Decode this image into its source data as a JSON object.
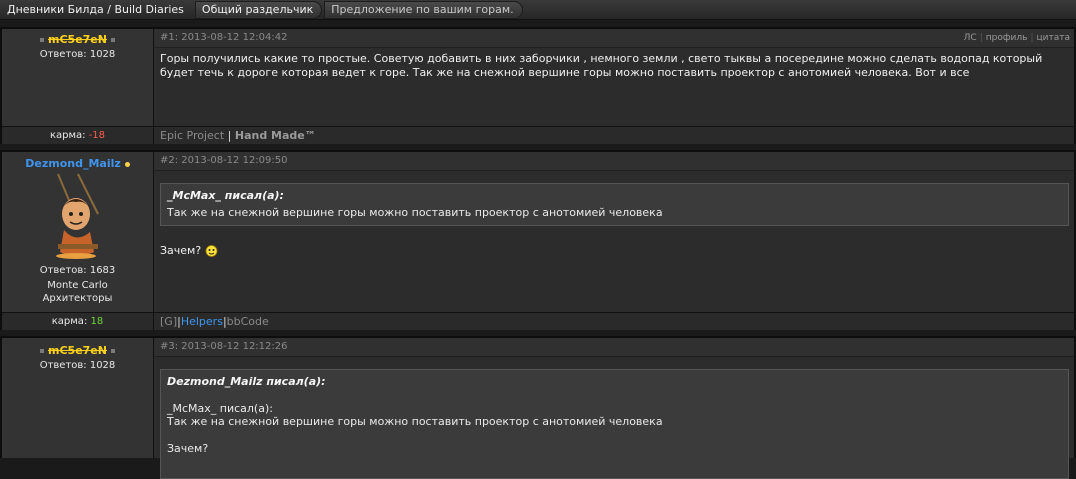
{
  "breadcrumbs": [
    "Дневники Билда / Build Diaries",
    "Общий раздельчик",
    "Предложение по вашим горам."
  ],
  "posts": [
    {
      "username": "mC5e7eN",
      "replies": "Ответов: 1028",
      "number_date": "#1: 2013-08-12 12:04:42",
      "actions": [
        "ЛС",
        "профиль",
        "цитата"
      ],
      "text": "Горы получились какие то простые. Советую добавить в них заборчики , немного земли , свето тыквы а посередине можно сделать водопад который будет течь к дороге которая ведет к горе. Так же на снежной вершине горы можно поставить проектор с анотомией человека. Вот и все",
      "karma_label": "карма:",
      "karma_value": "-18",
      "signature_a": "Epic Project",
      "signature_sep": "|",
      "signature_b": "Hand Made™"
    },
    {
      "username": "Dezmond_Mailz",
      "replies": "Ответов: 1683",
      "location": "Monte Carlo",
      "group": "Архитекторы",
      "number_date": "#2: 2013-08-12 12:09:50",
      "quote_author": "_McMax_ писал(а):",
      "quote_text": "Так же на снежной вершине горы можно поставить проектор с анотомией человека",
      "text": "Зачем?",
      "karma_label": "карма:",
      "karma_value": "18",
      "signature_g": "[G]",
      "signature_sep": "|",
      "signature_helpers": "Helpers",
      "signature_bb": "bbCode"
    },
    {
      "username": "mC5e7eN",
      "replies": "Ответов: 1028",
      "number_date": "#3: 2013-08-12 12:12:26",
      "quote_author": "Dezmond_Mailz писал(а):",
      "quote_line1": "_McMax_ писал(а):",
      "quote_line2": "Так же на снежной вершине горы можно поставить проектор с анотомией человека",
      "quote_line3": "Зачем?"
    }
  ],
  "colors": {
    "karma_negative": "#ff5b4d",
    "karma_positive": "#6cd63c",
    "username_gold": "#ffd11a",
    "username_blue": "#3f95f0"
  },
  "icons": [
    "smiley-icon",
    "online-dot-icon",
    "avatar-character"
  ]
}
